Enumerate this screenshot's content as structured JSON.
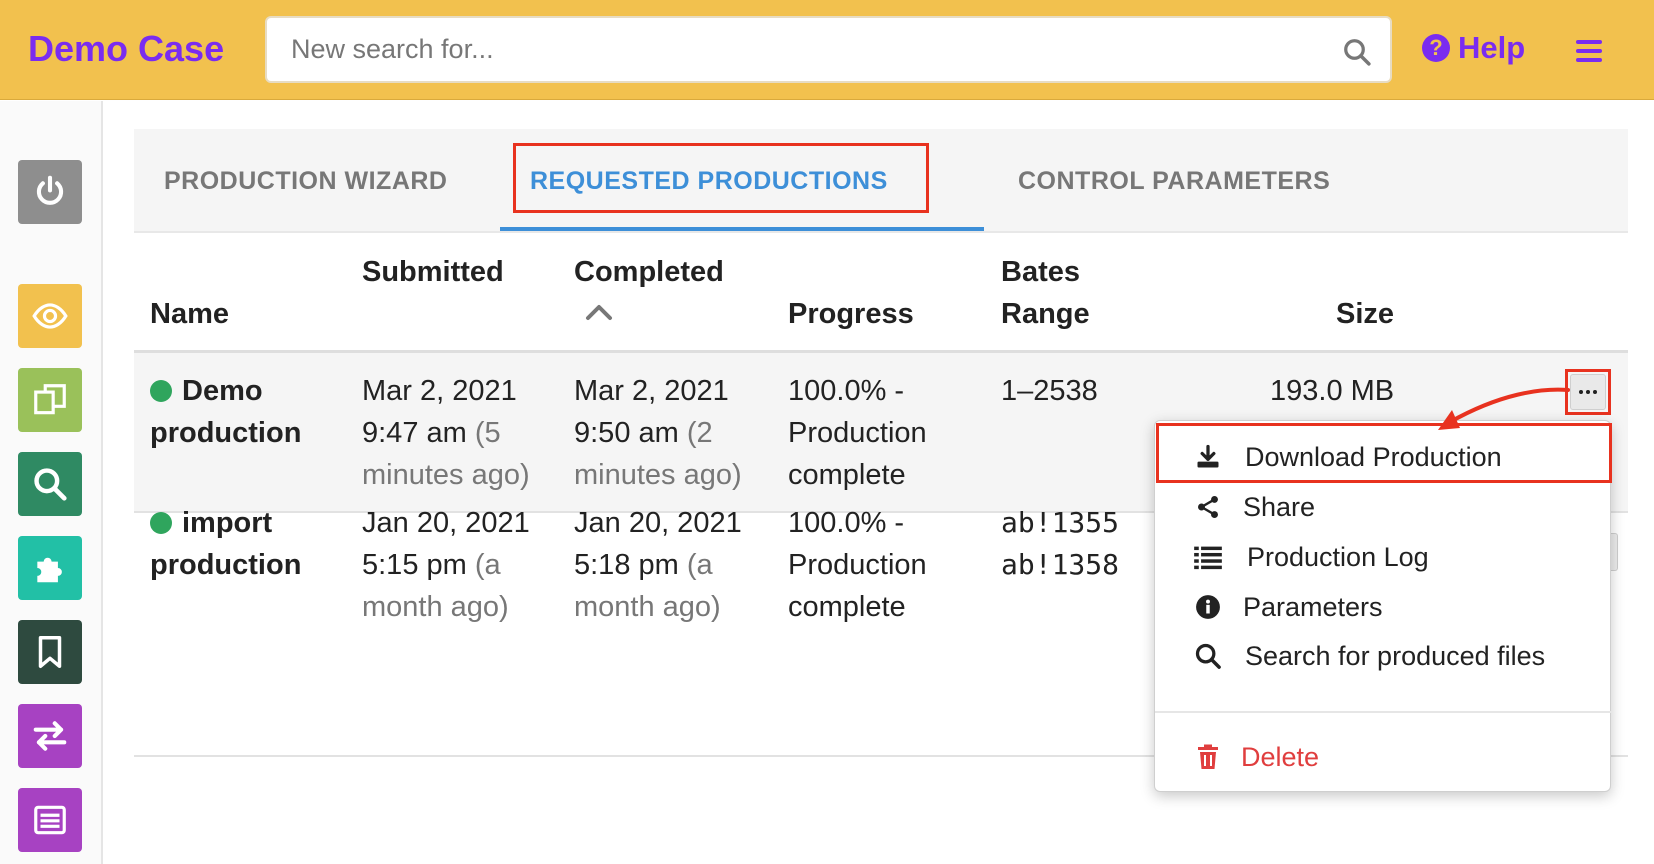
{
  "header": {
    "app_title": "Demo Case",
    "search_placeholder": "New search for...",
    "help_label": "Help"
  },
  "sidebar": {
    "items": [
      {
        "name": "power",
        "color": "#8e8e8e"
      },
      {
        "name": "review",
        "color": "#f2c14e"
      },
      {
        "name": "copies",
        "color": "#9ac15a"
      },
      {
        "name": "search",
        "color": "#2f8a63"
      },
      {
        "name": "plugins",
        "color": "#22c0a6"
      },
      {
        "name": "bookmark",
        "color": "#2e4a3f"
      },
      {
        "name": "transfer",
        "color": "#a742c2"
      },
      {
        "name": "list",
        "color": "#a742c2"
      }
    ]
  },
  "tabs": [
    {
      "label": "PRODUCTION WIZARD",
      "active": false
    },
    {
      "label": "REQUESTED PRODUCTIONS",
      "active": true
    },
    {
      "label": "CONTROL PARAMETERS",
      "active": false
    }
  ],
  "table": {
    "headers": {
      "name": "Name",
      "submitted": "Submitted",
      "completed": "Completed",
      "progress": "Progress",
      "bates_line1": "Bates",
      "bates_line2": "Range",
      "size": "Size"
    },
    "rows": [
      {
        "status_color": "#2fa55d",
        "name_line1": "Demo",
        "name_line2": "production",
        "submitted_line1": "Mar 2, 2021",
        "submitted_time": "9:47 am",
        "submitted_rel_a": "(5",
        "submitted_rel_b": "minutes ago)",
        "completed_line1": "Mar 2, 2021",
        "completed_time": "9:50 am",
        "completed_rel_a": "(2",
        "completed_rel_b": "minutes ago)",
        "progress_line1": "100.0% -",
        "progress_line2": "Production",
        "progress_line3": "complete",
        "bates": "1–2538",
        "size": "193.0 MB"
      },
      {
        "status_color": "#2fa55d",
        "name_line1": "import",
        "name_line2": "production",
        "submitted_line1": "Jan 20, 2021",
        "submitted_time": "5:15 pm",
        "submitted_rel_a": "(a",
        "submitted_rel_b": "month ago)",
        "completed_line1": "Jan 20, 2021",
        "completed_time": "5:18 pm",
        "completed_rel_a": "(a",
        "completed_rel_b": "month ago)",
        "progress_line1": "100.0% -",
        "progress_line2": "Production",
        "progress_line3": "complete",
        "bates_line1": "ab!1355",
        "bates_line2": "ab!1358"
      }
    ]
  },
  "dropdown": {
    "items": [
      {
        "label": "Download Production",
        "icon": "download-icon"
      },
      {
        "label": "Share",
        "icon": "share-icon"
      },
      {
        "label": "Production Log",
        "icon": "list-icon"
      },
      {
        "label": "Parameters",
        "icon": "info-icon"
      },
      {
        "label": "Search for produced files",
        "icon": "search-icon"
      }
    ],
    "delete_label": "Delete",
    "delete_color": "#e03e3e"
  },
  "annotation_color": "#e8321f",
  "accent_color": "#3d8fd8"
}
